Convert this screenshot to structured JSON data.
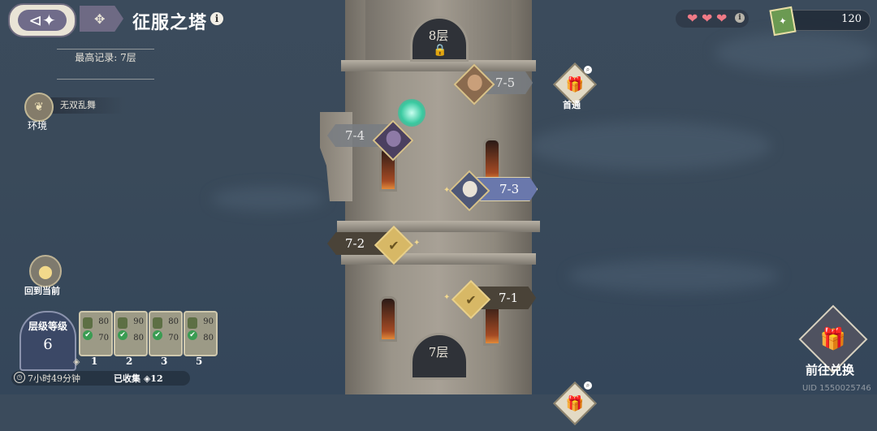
{
  "header": {
    "back_glyph": "⊲✦",
    "menu_glyph": "✥",
    "title": "征服之塔",
    "info_glyph": "i",
    "record": "最高记录: 7层"
  },
  "environment": {
    "name": "无双乱舞",
    "label": "环境"
  },
  "hearts": [
    "❤",
    "❤",
    "❤"
  ],
  "currency": {
    "value": "120",
    "icon": "ticket-icon"
  },
  "tower": {
    "upper_floor": "8层",
    "lower_floor": "7层"
  },
  "stages": [
    {
      "id": "7-5",
      "state": "locked"
    },
    {
      "id": "7-4",
      "state": "locked"
    },
    {
      "id": "7-3",
      "state": "current"
    },
    {
      "id": "7-2",
      "state": "cleared"
    },
    {
      "id": "7-1",
      "state": "cleared"
    }
  ],
  "first_clear_label": "首通",
  "return_label": "回到当前",
  "tier": {
    "label": "层级等级",
    "value": "6",
    "rewards": [
      {
        "top": "80",
        "bottom": "70",
        "tier": "1"
      },
      {
        "top": "90",
        "bottom": "80",
        "tier": "2"
      },
      {
        "top": "80",
        "bottom": "70",
        "tier": "3"
      },
      {
        "top": "90",
        "bottom": "80",
        "tier": "5"
      }
    ]
  },
  "timer": "7小时49分钟",
  "collected": "已收集 ◈12",
  "exchange_label": "前往兑换",
  "uid": "UID 1550025746"
}
